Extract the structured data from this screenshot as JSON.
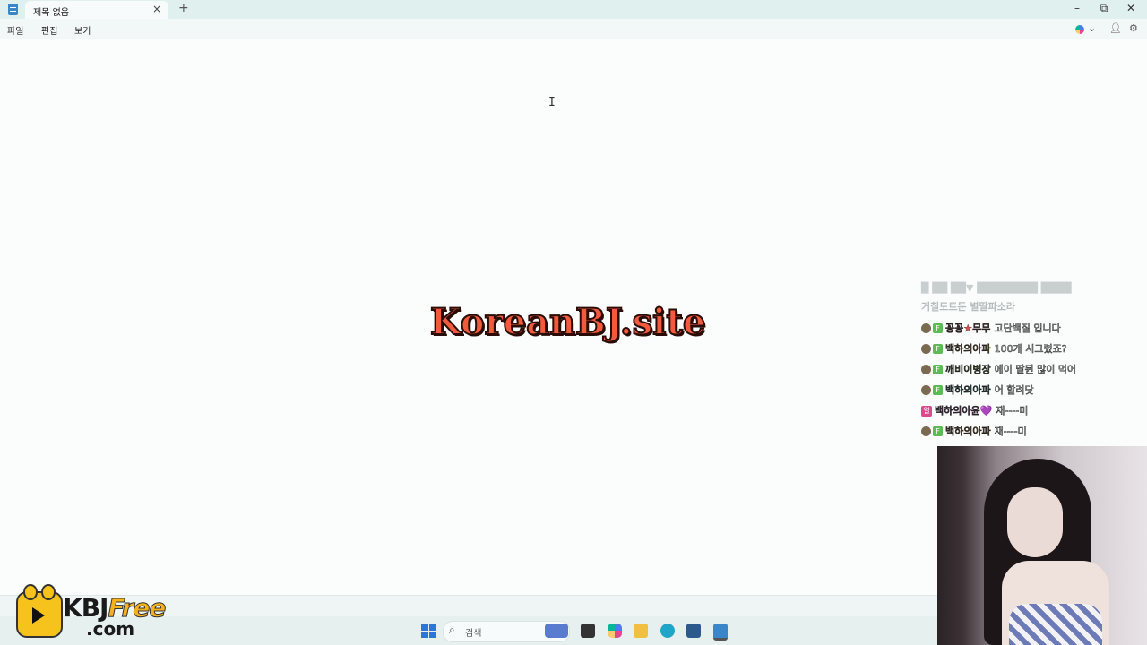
{
  "window": {
    "tab_title": "제목 없음",
    "tab_close": "×",
    "new_tab": "+",
    "minimize": "–",
    "maximize": "⧉",
    "close": "✕"
  },
  "menu": {
    "file": "파일",
    "edit": "편집",
    "view": "보기"
  },
  "editor": {
    "cursor": "I"
  },
  "watermark": "KoreanBJ.site",
  "chat": {
    "faded_line_1": "█ ██ ██▼ ████████ ████",
    "faded_line_2": "거칠도트둔 별딸파소라",
    "messages": [
      {
        "nick": "꽁꽁★무무",
        "text": "고단백질 입니다",
        "nick_color": "#e84a4a"
      },
      {
        "nick": "백하의아파",
        "text": "100개 시그렸죠?",
        "nick_color": "#e0a030"
      },
      {
        "nick": "깨비이병장",
        "text": "에이 딸뒨 많이 먹어",
        "nick_color": "#8fd14f"
      },
      {
        "nick": "백하의아파",
        "text": "어 할려닷",
        "nick_color": "#3aa6a0"
      },
      {
        "nick": "백하의아윤💜",
        "text": "재----미",
        "nick_color": "#c050c0",
        "vip": true
      },
      {
        "nick": "백하의아파",
        "text": "재----미",
        "nick_color": "#e08a30"
      }
    ]
  },
  "taskbar": {
    "search_label": "검색"
  },
  "logo": {
    "brand": "KBJ",
    "brand_free": "Free",
    "domain": ".com"
  }
}
